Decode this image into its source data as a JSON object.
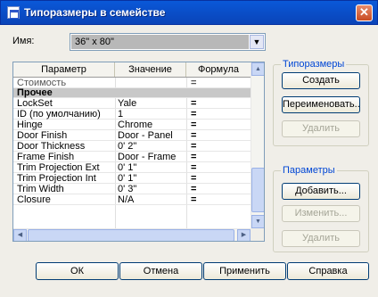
{
  "window": {
    "title": "Типоразмеры в семействе",
    "close_glyph": "✕"
  },
  "name_field": {
    "label": "Имя:",
    "value": "36\" x 80\"",
    "dropdown_glyph": "▼"
  },
  "grid": {
    "columns": [
      "Параметр",
      "Значение",
      "Формула"
    ],
    "rows": [
      {
        "type": "cut",
        "param": "Стоимость",
        "value": "",
        "formula": "="
      },
      {
        "type": "group",
        "param": "Прочее",
        "value": "",
        "formula": ""
      },
      {
        "type": "row",
        "param": "LockSet",
        "value": "Yale",
        "formula": "="
      },
      {
        "type": "row",
        "param": "ID (по умолчанию)",
        "value": "1",
        "formula": "="
      },
      {
        "type": "row",
        "param": "Hinge",
        "value": "Chrome",
        "formula": "="
      },
      {
        "type": "row",
        "param": "Door Finish",
        "value": "Door - Panel",
        "formula": "="
      },
      {
        "type": "row",
        "param": "Door Thickness",
        "value": "0' 2\"",
        "formula": "="
      },
      {
        "type": "row",
        "param": "Frame Finish",
        "value": "Door - Frame",
        "formula": "="
      },
      {
        "type": "row",
        "param": "Trim Projection Ext",
        "value": "0' 1\"",
        "formula": "="
      },
      {
        "type": "row",
        "param": "Trim Projection Int",
        "value": "0' 1\"",
        "formula": "="
      },
      {
        "type": "row",
        "param": "Trim Width",
        "value": "0' 3\"",
        "formula": "="
      },
      {
        "type": "row",
        "param": "Closure",
        "value": "N/A",
        "formula": "="
      }
    ],
    "scroll_up_glyph": "▲",
    "scroll_down_glyph": "▼",
    "scroll_left_glyph": "◀",
    "scroll_right_glyph": "▶"
  },
  "types_group": {
    "title": "Типоразмеры",
    "new_label": "Создать",
    "rename_label": "Переименовать...",
    "delete_label": "Удалить"
  },
  "params_group": {
    "title": "Параметры",
    "add_label": "Добавить...",
    "modify_label": "Изменить...",
    "remove_label": "Удалить"
  },
  "footer": {
    "ok_label": "ОК",
    "cancel_label": "Отмена",
    "apply_label": "Применить",
    "help_label": "Справка"
  }
}
